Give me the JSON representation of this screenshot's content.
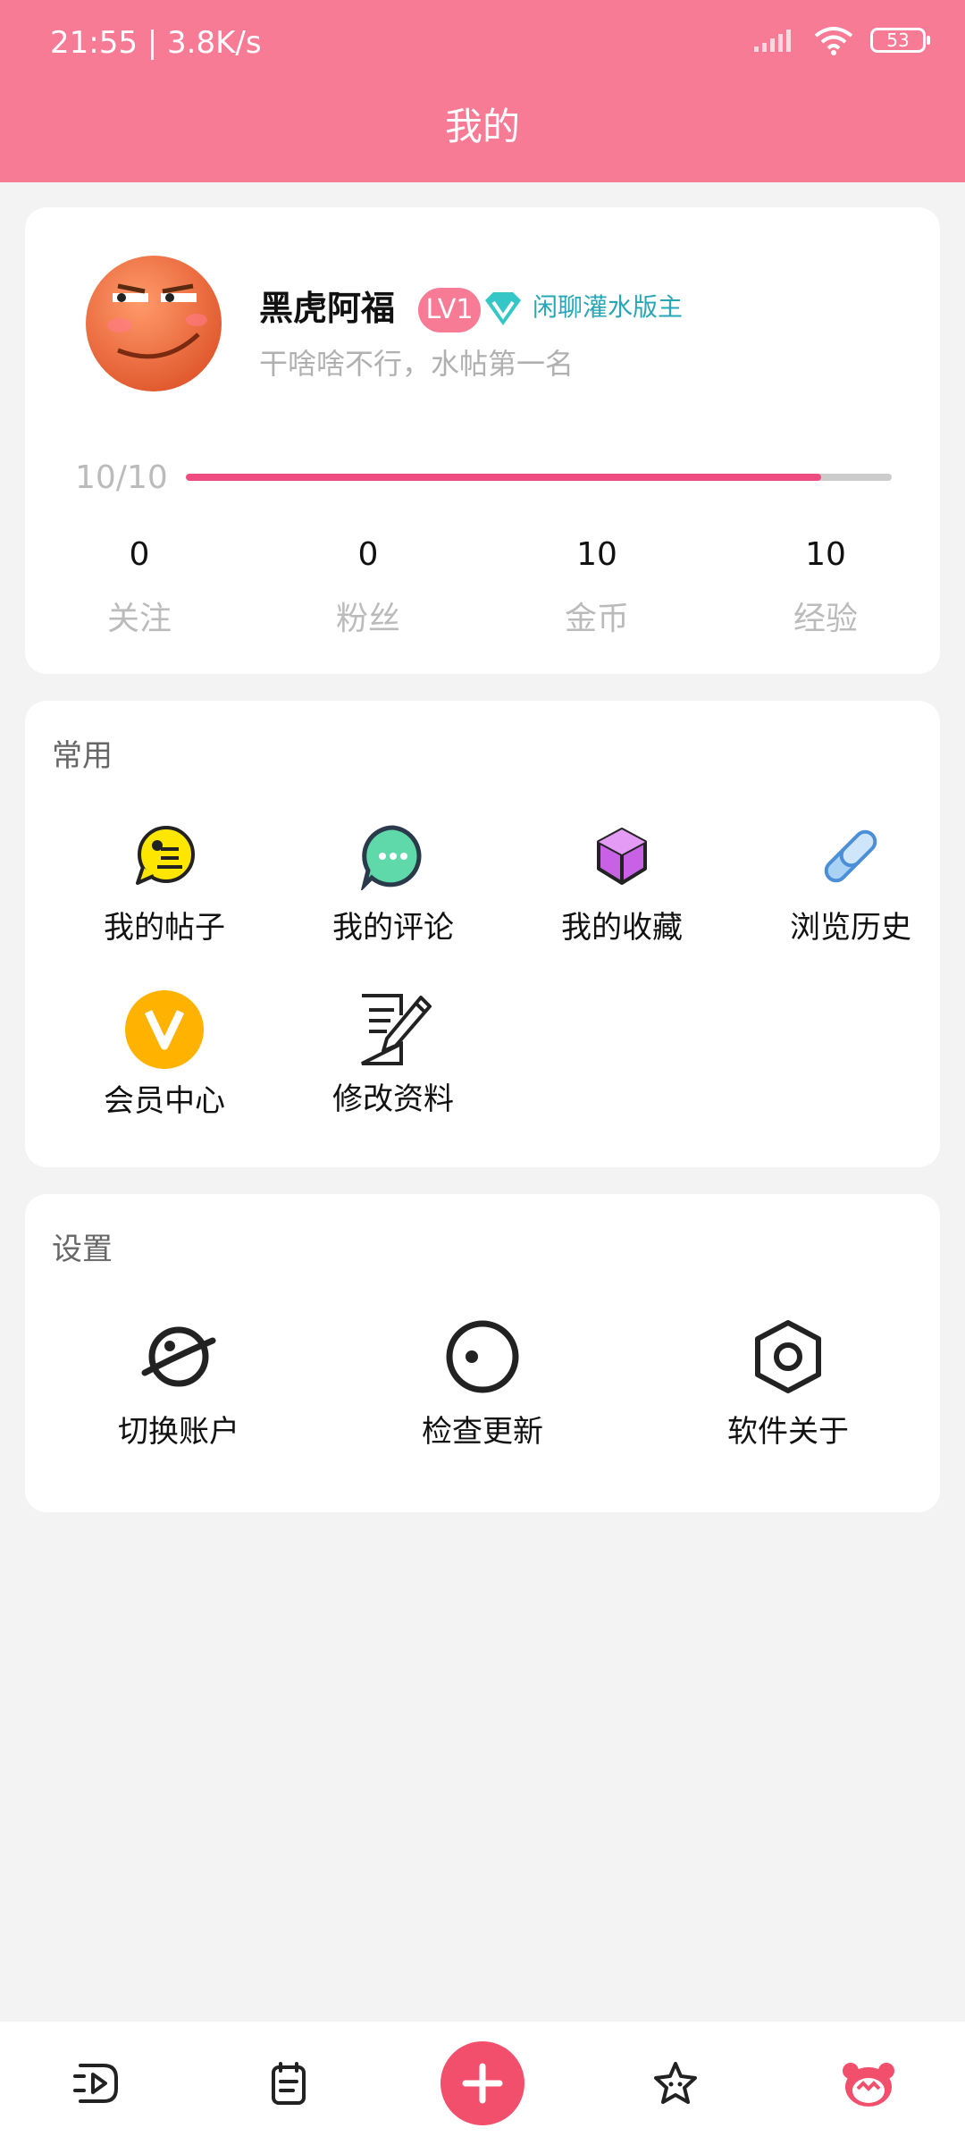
{
  "status_bar": {
    "time": "21:55 | 3.8K/s",
    "battery": "53"
  },
  "header": {
    "title": "我的"
  },
  "profile": {
    "username": "黑虎阿福",
    "level_badge": "LV1",
    "moderator_title": "闲聊灌水版主",
    "signature": "干啥啥不行，水帖第一名",
    "experience": {
      "text": "10/10",
      "progress": 0.9
    },
    "stats": [
      {
        "value": "0",
        "label": "关注"
      },
      {
        "value": "0",
        "label": "粉丝"
      },
      {
        "value": "10",
        "label": "金币"
      },
      {
        "value": "10",
        "label": "经验"
      }
    ]
  },
  "common": {
    "title": "常用",
    "items": [
      {
        "label": "我的帖子",
        "icon": "post-bubble-icon"
      },
      {
        "label": "我的评论",
        "icon": "comment-bubble-icon"
      },
      {
        "label": "我的收藏",
        "icon": "cube-icon"
      },
      {
        "label": "浏览历史",
        "icon": "link-icon"
      },
      {
        "label": "会员中心",
        "icon": "vip-icon"
      },
      {
        "label": "修改资料",
        "icon": "edit-document-icon"
      }
    ]
  },
  "settings": {
    "title": "设置",
    "items": [
      {
        "label": "切换账户",
        "icon": "planet-switch-icon"
      },
      {
        "label": "检查更新",
        "icon": "radio-circle-icon"
      },
      {
        "label": "软件关于",
        "icon": "hexagon-nut-icon"
      }
    ]
  },
  "bottom_nav": [
    "video-icon",
    "clipboard-icon",
    "plus-icon",
    "star-face-icon",
    "mascot-icon"
  ],
  "colors": {
    "accent": "#f87b96",
    "progress": "#ee4b80",
    "vip": "#ffb300",
    "teal": "#27a7b5"
  }
}
